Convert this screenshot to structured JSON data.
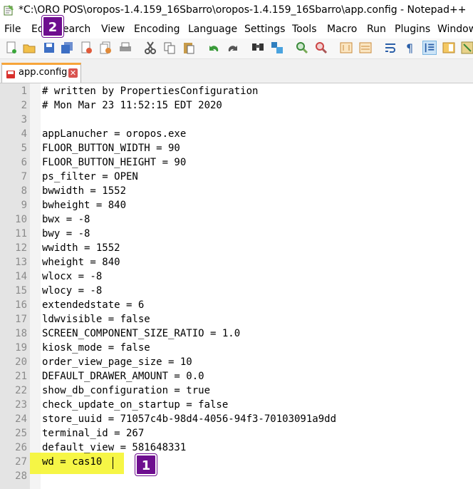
{
  "window": {
    "title": "*C:\\ORO POS\\oropos-1.4.159_16Sbarro\\oropos-1.4.159_16Sbarro\\app.config - Notepad++"
  },
  "menu": [
    "File",
    "Ed",
    "earch",
    "View",
    "Encoding",
    "Language",
    "Settings",
    "Tools",
    "Macro",
    "Run",
    "Plugins",
    "Window"
  ],
  "tab": {
    "label": "app.config",
    "close": "✕"
  },
  "editor": {
    "line_numbers": [
      "1",
      "2",
      "3",
      "4",
      "5",
      "6",
      "7",
      "8",
      "9",
      "10",
      "11",
      "12",
      "13",
      "14",
      "15",
      "16",
      "17",
      "18",
      "19",
      "20",
      "21",
      "22",
      "23",
      "24",
      "25",
      "26",
      "27",
      "28"
    ],
    "lines": [
      "# written by PropertiesConfiguration",
      "# Mon Mar 23 11:52:15 EDT 2020",
      "",
      "appLanucher = oropos.exe",
      "FLOOR_BUTTON_WIDTH = 90",
      "FLOOR_BUTTON_HEIGHT = 90",
      "ps_filter = OPEN",
      "bwwidth = 1552",
      "bwheight = 840",
      "bwx = -8",
      "bwy = -8",
      "wwidth = 1552",
      "wheight = 840",
      "wlocx = -8",
      "wlocy = -8",
      "extendedstate = 6",
      "ldwvisible = false",
      "SCREEN_COMPONENT_SIZE_RATIO = 1.0",
      "kiosk_mode = false",
      "order_view_page_size = 10",
      "DEFAULT_DRAWER_AMOUNT = 0.0",
      "show_db_configuration = true",
      "check_update_on_startup = false",
      "store_uuid = 71057c4b-98d4-4056-94f3-70103091a9dd",
      "terminal_id = 267",
      "default_view = 581648331",
      "wd = cas10",
      ""
    ],
    "current_line": 27
  },
  "annotations": {
    "badge1": "1",
    "badge2": "2",
    "highlight_color": "#f5f532",
    "badge_color": "#6e0e8f"
  },
  "toolbar_icons": [
    "new-file-icon",
    "open-file-icon",
    "save-icon",
    "save-all-icon",
    "close-icon",
    "close-all-icon",
    "print-icon",
    "cut-icon",
    "copy-icon",
    "paste-icon",
    "undo-icon",
    "redo-icon",
    "find-icon",
    "replace-icon",
    "zoom-in-icon",
    "zoom-out-icon",
    "sync-vertical-icon",
    "sync-horizontal-icon",
    "word-wrap-icon",
    "show-all-chars-icon",
    "indent-guide-icon",
    "doc-map-icon",
    "function-list-icon"
  ]
}
